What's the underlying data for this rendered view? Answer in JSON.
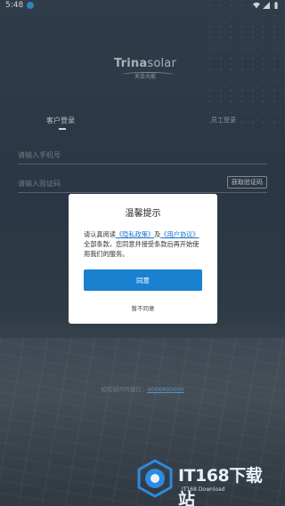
{
  "status_bar": {
    "time": "5:48"
  },
  "logo": {
    "brand_bold": "Trina",
    "brand_light": "solar",
    "sub": "天合光能"
  },
  "tabs": {
    "customer_login": "客户登录",
    "staff_login": "员工登录"
  },
  "form": {
    "phone_placeholder": "请输入手机号",
    "code_placeholder": "请输入验证码",
    "get_code_label": "获取验证码"
  },
  "hotline": {
    "text": "如有疑问可拨打：",
    "number": "4006890000"
  },
  "dialog": {
    "title": "温馨提示",
    "body_prefix": "请认真阅读",
    "privacy_link": "《隐私政策》",
    "and": "及",
    "user_link": "《用户协议》",
    "body_suffix": "全部条款，您同意并接受条款后再开始使用我们的服务。",
    "agree_label": "同意",
    "disagree_label": "暂不同意"
  },
  "watermark": {
    "brand": "IT168下载站",
    "sub": "IT168 Download"
  },
  "colors": {
    "accent": "#1a80d0",
    "link": "#1a73c8",
    "background": "#3a4a5a"
  }
}
